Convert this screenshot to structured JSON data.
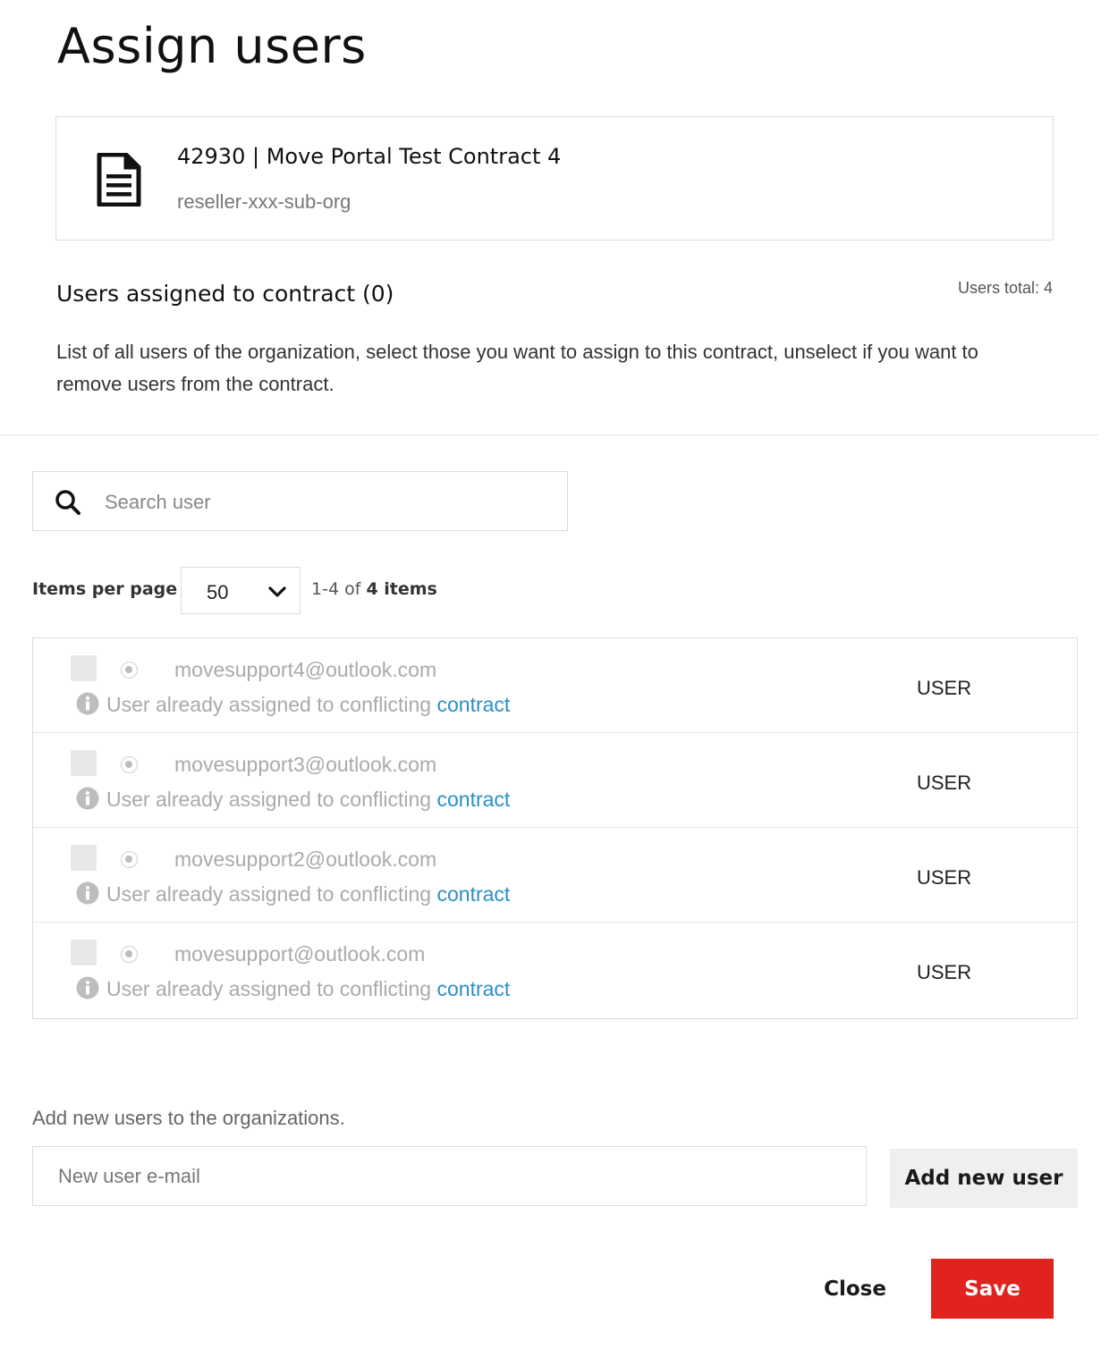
{
  "dialog": {
    "title": "Assign users"
  },
  "contract": {
    "icon": "document-icon",
    "name": "42930 | Move Portal Test Contract 4",
    "org": "reseller-xxx-sub-org"
  },
  "assigned": {
    "title": "Users assigned to contract (0)",
    "users_total": "Users total: 4",
    "description": "List of all users of the organization, select those you want to assign to this contract, unselect if you want to remove users from the contract."
  },
  "search": {
    "icon": "search-icon",
    "placeholder": "Search user"
  },
  "pagination": {
    "items_per_page_label": "Items per page",
    "items_per_page_value": "50",
    "range_prefix": "1-4 of",
    "range_total": "4 items"
  },
  "users": [
    {
      "email": "movesupport4@outlook.com",
      "conflict_text": "User already assigned to conflicting",
      "conflict_link": "contract",
      "role": "USER"
    },
    {
      "email": "movesupport3@outlook.com",
      "conflict_text": "User already assigned to conflicting",
      "conflict_link": "contract",
      "role": "USER"
    },
    {
      "email": "movesupport2@outlook.com",
      "conflict_text": "User already assigned to conflicting",
      "conflict_link": "contract",
      "role": "USER"
    },
    {
      "email": "movesupport@outlook.com",
      "conflict_text": "User already assigned to conflicting",
      "conflict_link": "contract",
      "role": "USER"
    }
  ],
  "add_user": {
    "label": "Add new users to the organizations.",
    "placeholder": "New user e-mail",
    "button_label": "Add new user"
  },
  "actions": {
    "close_label": "Close",
    "save_label": "Save"
  },
  "colors": {
    "accent_red": "#e0231e",
    "link_blue": "#2a8fc9"
  }
}
